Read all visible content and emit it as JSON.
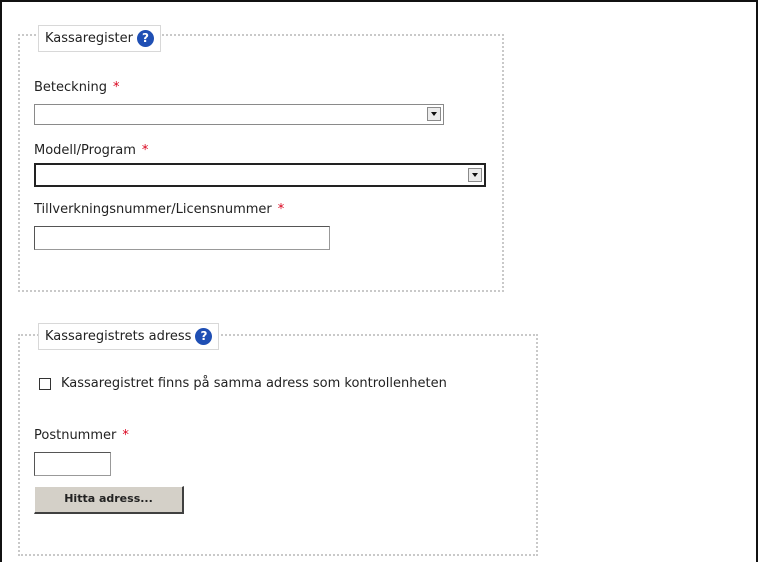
{
  "kassaregister": {
    "legend": "Kassaregister",
    "beteckning_label": "Beteckning",
    "modell_label": "Modell/Program",
    "tillverkning_label": "Tillverkningsnummer/Licensnummer",
    "required_mark": "*"
  },
  "adress": {
    "legend": "Kassaregistrets adress",
    "same_address_label": "Kassaregistret finns på samma adress som kontrollenheten",
    "postnummer_label": "Postnummer",
    "required_mark": "*",
    "find_button": "Hitta adress..."
  },
  "help_glyph": "?"
}
